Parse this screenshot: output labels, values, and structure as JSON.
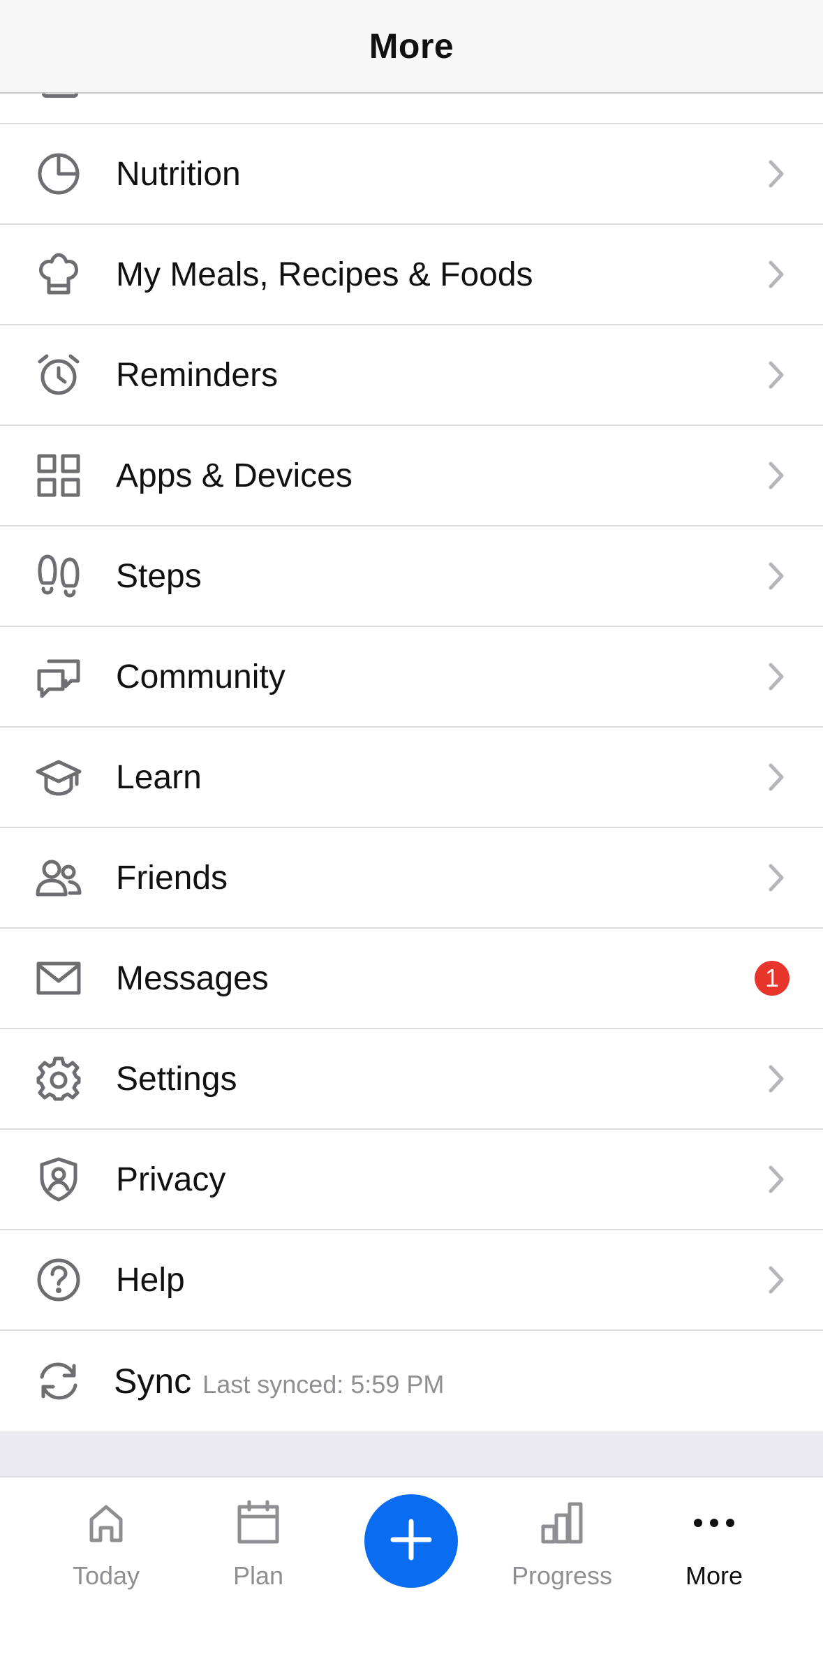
{
  "header": {
    "title": "More"
  },
  "menu": {
    "items": [
      {
        "label": "Nutrition",
        "icon": "pie-chart-icon"
      },
      {
        "label": "My Meals, Recipes & Foods",
        "icon": "chef-hat-icon"
      },
      {
        "label": "Reminders",
        "icon": "alarm-clock-icon"
      },
      {
        "label": "Apps & Devices",
        "icon": "grid-icon"
      },
      {
        "label": "Steps",
        "icon": "footprints-icon"
      },
      {
        "label": "Community",
        "icon": "chat-bubbles-icon"
      },
      {
        "label": "Learn",
        "icon": "graduation-cap-icon"
      },
      {
        "label": "Friends",
        "icon": "people-icon"
      },
      {
        "label": "Messages",
        "icon": "envelope-icon",
        "badge": "1"
      },
      {
        "label": "Settings",
        "icon": "gear-icon"
      },
      {
        "label": "Privacy",
        "icon": "shield-user-icon"
      },
      {
        "label": "Help",
        "icon": "question-circle-icon"
      }
    ],
    "sync": {
      "label": "Sync",
      "status": "Last synced: 5:59 PM",
      "icon": "sync-icon"
    }
  },
  "tabbar": {
    "tabs": [
      {
        "label": "Today",
        "icon": "home-icon"
      },
      {
        "label": "Plan",
        "icon": "calendar-icon"
      },
      {
        "label": "Progress",
        "icon": "bar-chart-icon"
      },
      {
        "label": "More",
        "icon": "more-dots-icon",
        "active": true
      }
    ],
    "add_button_icon": "plus-icon"
  },
  "colors": {
    "accent": "#0a6cf0",
    "badge": "#e8352c",
    "icon_gray": "#6d6d72",
    "chevron_gray": "#b5b5ba",
    "secondary_text": "#8e8e93"
  }
}
